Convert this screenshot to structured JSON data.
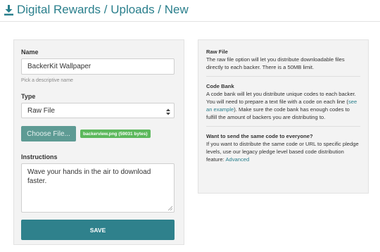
{
  "header": {
    "icon": "download-icon",
    "title": "Digital Rewards / Uploads / New"
  },
  "form": {
    "name_label": "Name",
    "name_value": "BackerKit Wallpaper",
    "name_help": "Pick a descriptive name",
    "type_label": "Type",
    "type_value": "Raw File",
    "choose_file_label": "Choose File...",
    "file_badge": "backerview.png (59031 bytes)",
    "instructions_label": "Instructions",
    "instructions_value": "Wave your hands in the air to download faster.",
    "save_label": "SAVE"
  },
  "info": {
    "raw_file_title": "Raw File",
    "raw_file_text": "The raw file option will let you distribute downloadable files directly to each backer. There is a 50MB limit.",
    "code_bank_title": "Code Bank",
    "code_bank_text_1": "A code bank will let you distribute unique codes to each backer. You will need to prepare a text file with a code on each line (",
    "code_bank_link": "see an example",
    "code_bank_text_2": "). Make sure the code bank has enough codes to fulfill the amount of backers you are distributing to.",
    "same_code_title": "Want to send the same code to everyone?",
    "same_code_text": "If you want to distribute the same code or URL to specific pledge levels, use our legacy pledge level based code distribution feature: ",
    "same_code_link": "Advanced"
  },
  "colors": {
    "accent": "#2a7f8c",
    "save_button": "#2f818c",
    "choose_button": "#5e9b94",
    "file_badge": "#5cb85c",
    "panel_bg": "#f3f3f3"
  }
}
